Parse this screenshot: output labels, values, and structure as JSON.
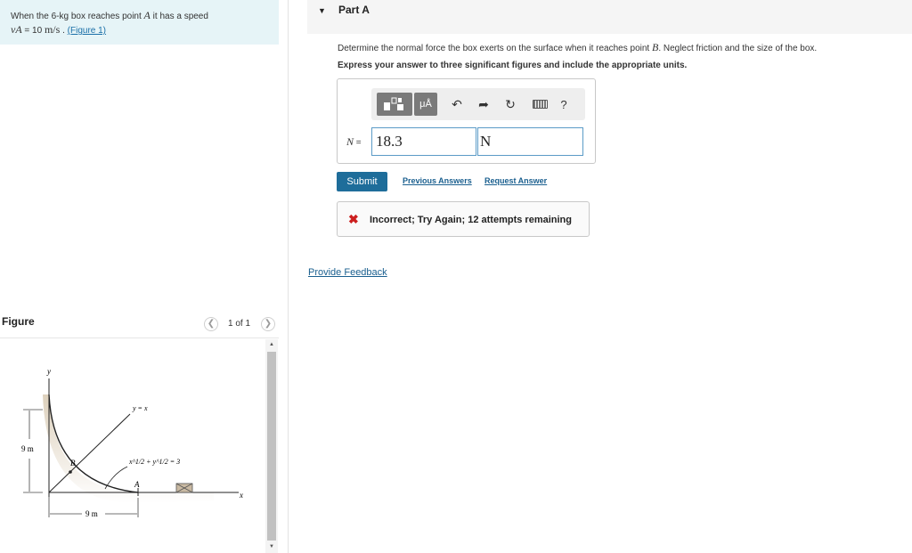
{
  "problem": {
    "text_before": "When the ",
    "mass": "6-kg",
    "text_mid": " box reaches point ",
    "point": "A",
    "text_after": " it has a speed",
    "speed_symbol": "vA",
    "speed_eq": " = 10 ",
    "speed_unit": "m/s",
    "sep": " . ",
    "figure_link": "(Figure 1)"
  },
  "figure": {
    "title": "Figure",
    "pager": "1 of 1",
    "label_y": "y",
    "label_x": "x",
    "label_yx": "y = x",
    "label_eq": "x^1/2 + y^1/2 = 3",
    "label_B": "B",
    "label_A": "A",
    "label_9m_vert": "9 m",
    "label_9m_horiz": "9 m"
  },
  "part": {
    "label": "Part A"
  },
  "question": {
    "prefix": "Determine the normal force the box exerts on the surface when it reaches point ",
    "point": "B",
    "suffix": ". Neglect friction and the size of the box.",
    "instruction": "Express your answer to three significant figures and include the appropriate units."
  },
  "toolbar": {
    "units_label": "μÅ",
    "help_label": "?"
  },
  "answer": {
    "var": "N",
    "eq": " =",
    "value": "18.3",
    "unit": "N"
  },
  "actions": {
    "submit": "Submit",
    "previous_answers": "Previous Answers",
    "request_answer": "Request Answer"
  },
  "feedback": {
    "icon": "✖",
    "text": "Incorrect; Try Again; 12 attempts remaining"
  },
  "footer": {
    "provide_feedback": "Provide Feedback"
  },
  "colors": {
    "problem_bg": "#e6f4f7",
    "submit_bg": "#1e6d9a",
    "error_red": "#cc1f1f",
    "link_blue": "#1a5f8f"
  }
}
